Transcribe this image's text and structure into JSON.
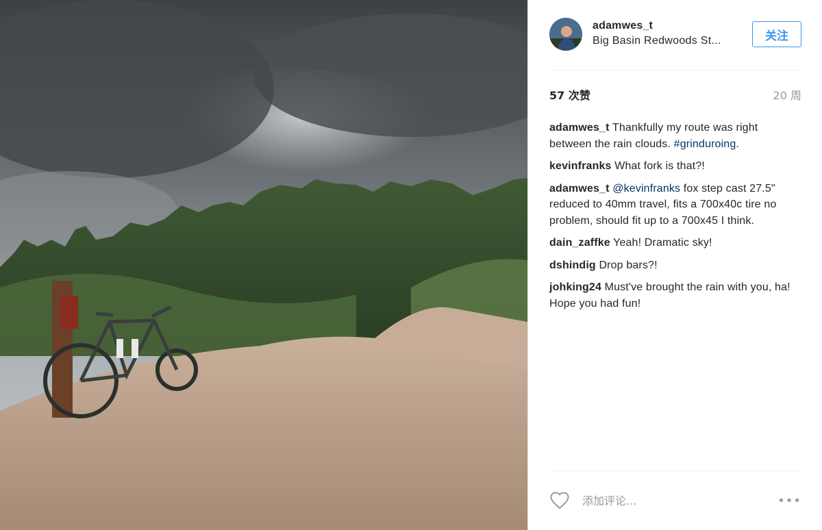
{
  "post": {
    "username": "adamwes_t",
    "location": "Big Basin Redwoods St...",
    "follow_label": "关注",
    "likes": "57 次赞",
    "time_ago": "20 周",
    "comments": [
      {
        "author": "adamwes_t",
        "parts": [
          {
            "type": "text",
            "value": " Thankfully my route was right between the rain clouds. "
          },
          {
            "type": "tag",
            "value": "#grinduroing"
          },
          {
            "type": "text",
            "value": "."
          }
        ]
      },
      {
        "author": "kevinfranks",
        "parts": [
          {
            "type": "text",
            "value": " What fork is that?!"
          }
        ]
      },
      {
        "author": "adamwes_t",
        "parts": [
          {
            "type": "text",
            "value": " "
          },
          {
            "type": "mention",
            "value": "@kevinfranks"
          },
          {
            "type": "text",
            "value": " fox step cast 27.5\" reduced to 40mm travel, fits a 700x40c tire no problem, should fit up to a 700x45 I think."
          }
        ]
      },
      {
        "author": "dain_zaffke",
        "parts": [
          {
            "type": "text",
            "value": " Yeah! Dramatic sky!"
          }
        ]
      },
      {
        "author": "dshindig",
        "parts": [
          {
            "type": "text",
            "value": " Drop bars?!"
          }
        ]
      },
      {
        "author": "johking24",
        "parts": [
          {
            "type": "text",
            "value": " Must've brought the rain with you, ha! Hope you had fun!"
          }
        ]
      }
    ],
    "add_comment_placeholder": "添加评论...",
    "more_label": "•••"
  },
  "icons": {
    "like": "heart-outline-icon",
    "options": "ellipsis-icon"
  },
  "colors": {
    "link": "#003569",
    "follow": "#3897f0",
    "muted": "#999999"
  }
}
